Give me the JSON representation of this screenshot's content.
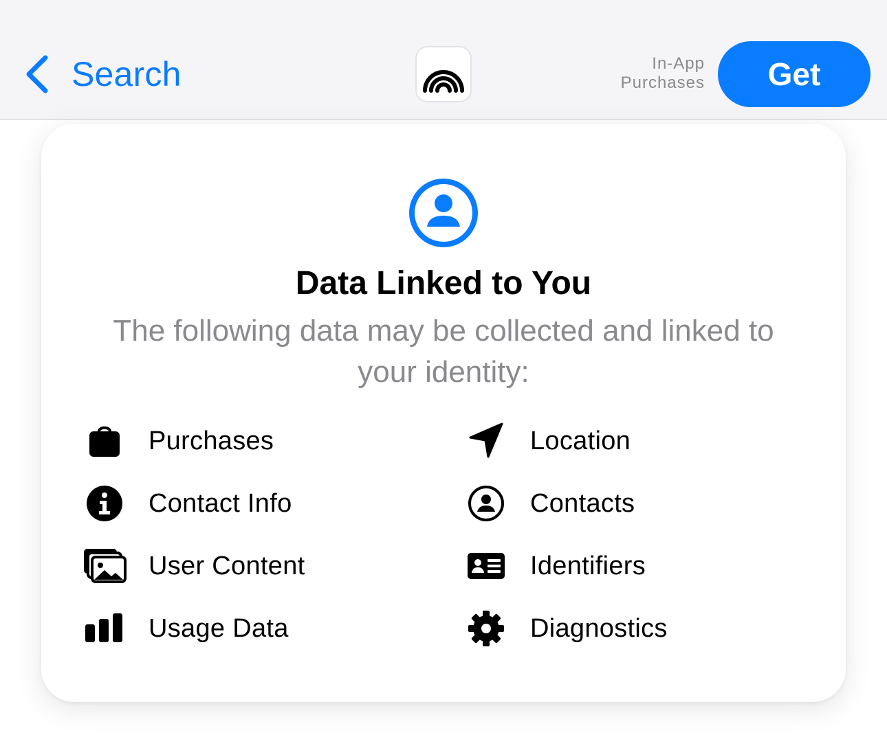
{
  "header": {
    "back_label": "Search",
    "back_icon": "chevron-left-icon",
    "app_icon": "app-logo-arcs-icon",
    "iap_line1": "In-App",
    "iap_line2": "Purchases",
    "get_label": "Get"
  },
  "card": {
    "icon": "person-circle-icon",
    "title": "Data Linked to You",
    "description": "The following data may be collected and linked to your identity:",
    "items": [
      {
        "label": "Purchases",
        "icon": "shopping-bag-icon"
      },
      {
        "label": "Location",
        "icon": "location-arrow-icon"
      },
      {
        "label": "Contact Info",
        "icon": "info-circle-icon"
      },
      {
        "label": "Contacts",
        "icon": "person-circle-outline-icon"
      },
      {
        "label": "User Content",
        "icon": "photos-icon"
      },
      {
        "label": "Identifiers",
        "icon": "id-card-icon"
      },
      {
        "label": "Usage Data",
        "icon": "bar-chart-icon"
      },
      {
        "label": "Diagnostics",
        "icon": "gear-icon"
      }
    ]
  },
  "colors": {
    "accent": "#0a7cff",
    "secondary_text": "#8a8a8e",
    "nav_background": "#f5f5f7"
  }
}
